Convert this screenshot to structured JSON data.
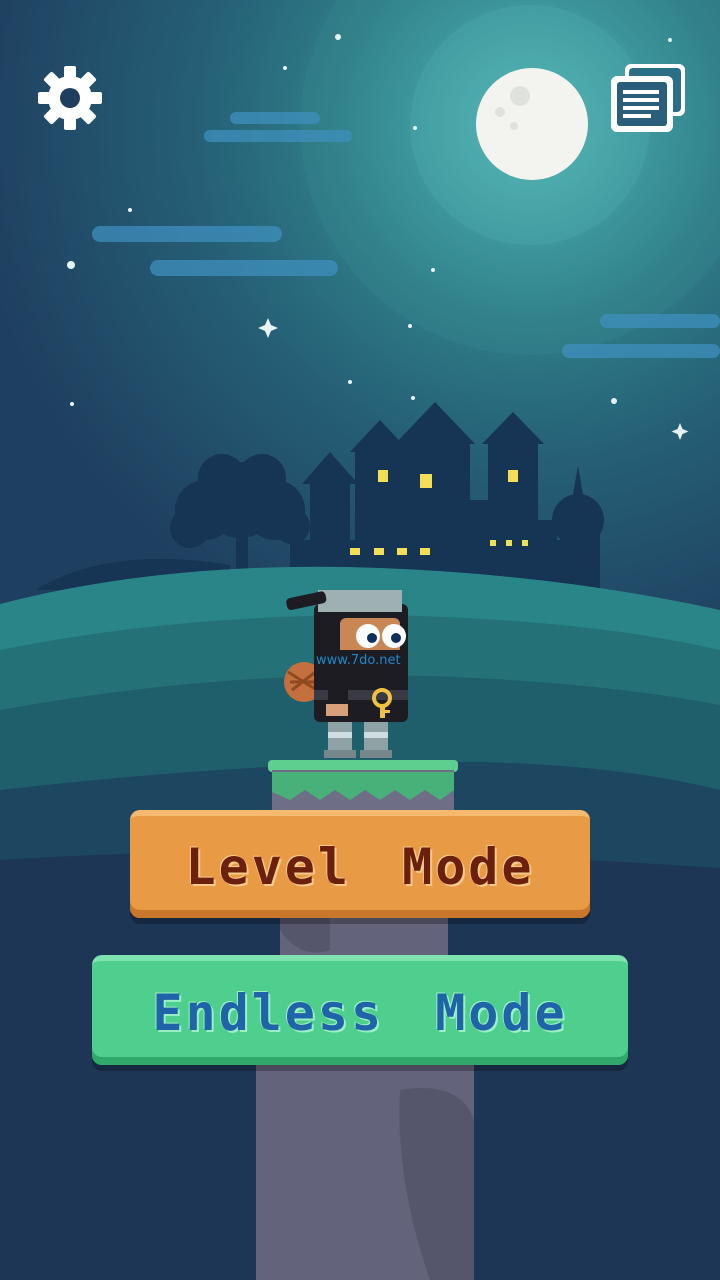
{
  "menu": {
    "level_mode_label": "Level Mode",
    "endless_mode_label": "Endless Mode"
  },
  "icons": {
    "settings": "gear-icon",
    "cards": "stacked-cards-icon"
  },
  "watermark": {
    "text": "www.7do.net"
  },
  "colors": {
    "sky": "#1f3554",
    "moon": "#f3f3ef",
    "level_button": "#e99a44",
    "level_text": "#6a200c",
    "endless_button": "#4fcf8d",
    "endless_text": "#1f63a8"
  }
}
